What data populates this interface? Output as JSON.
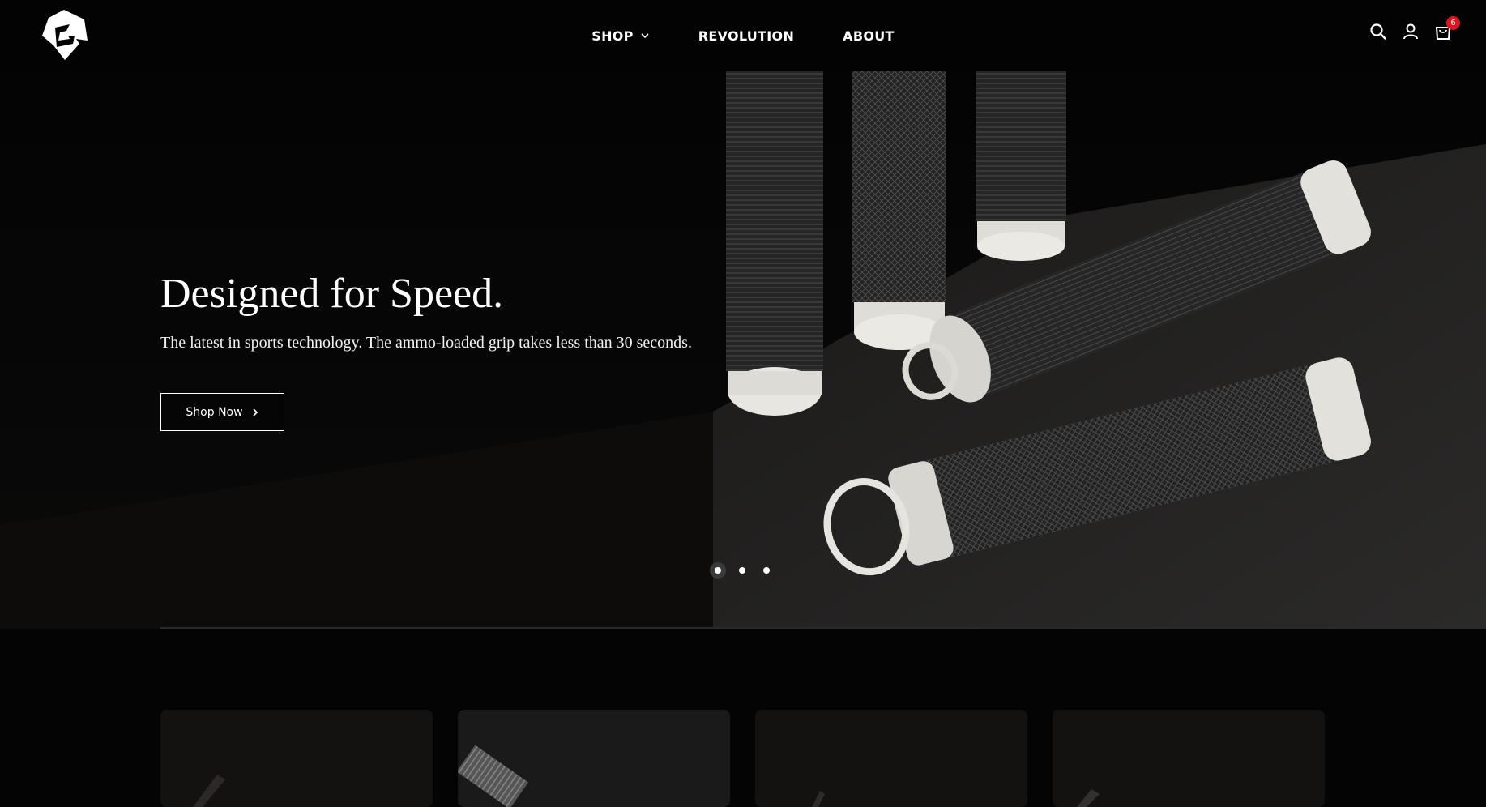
{
  "header": {
    "logo_icon": "g-brand-logo-icon",
    "nav": [
      {
        "label": "SHOP",
        "has_dropdown": true
      },
      {
        "label": "REVOLUTION",
        "has_dropdown": false
      },
      {
        "label": "ABOUT",
        "has_dropdown": false
      }
    ],
    "icons": [
      "search-icon",
      "account-icon",
      "cart-icon"
    ],
    "cart_count": "6"
  },
  "hero": {
    "title": "Designed for Speed.",
    "subtitle": "The latest in sports technology. The ammo-loaded grip takes less than 30 seconds.",
    "cta_label": "Shop Now",
    "slides_total": 3,
    "active_slide": 1
  },
  "products": {
    "cards_visible": 4
  },
  "colors": {
    "background": "#040404",
    "badge": "#e0141f",
    "text": "#ffffff"
  }
}
